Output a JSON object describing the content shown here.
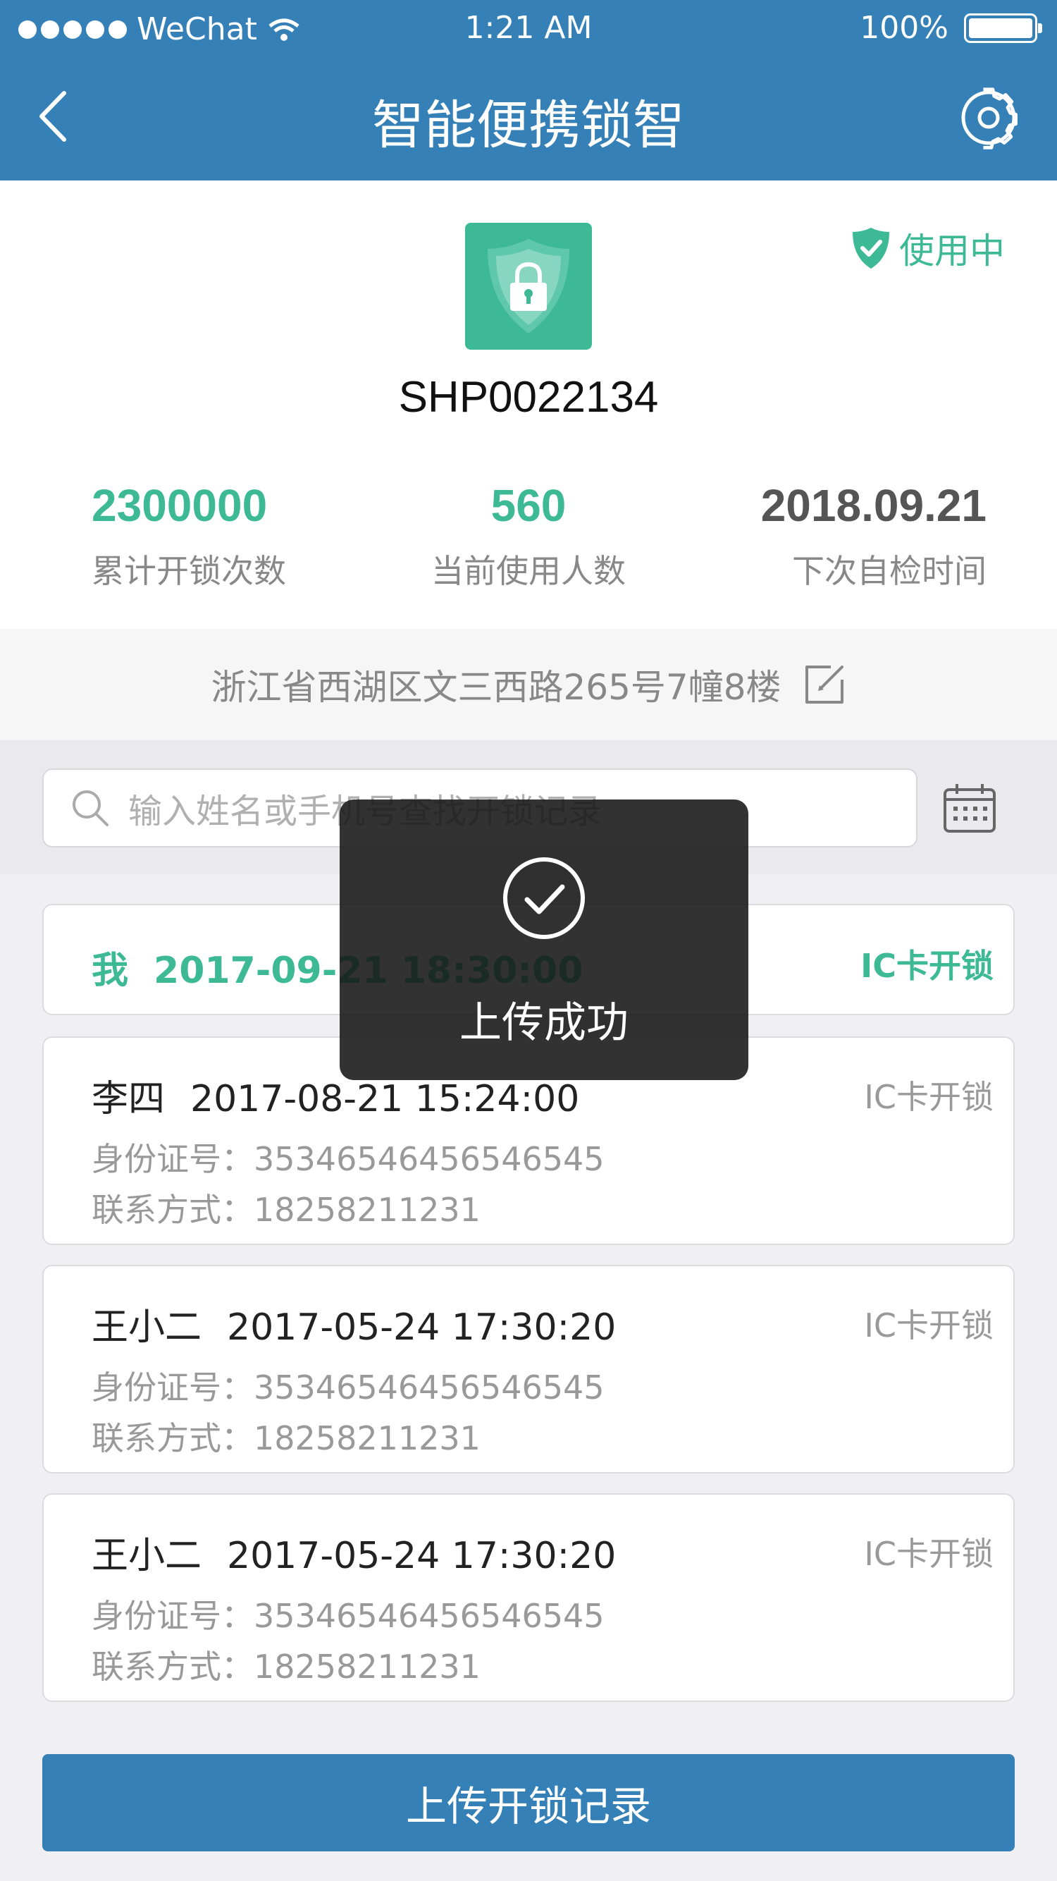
{
  "status_bar": {
    "carrier": "WeChat",
    "time": "1:21 AM",
    "battery": "100%"
  },
  "nav": {
    "title": "智能便携锁智",
    "back_icon": "chevron-left-icon",
    "settings_icon": "gear-icon"
  },
  "device": {
    "logo_icon": "shield-lock-icon",
    "status": "使用中",
    "id": "SHP0022134",
    "stats": [
      {
        "value": "2300000",
        "label": "累计开锁次数"
      },
      {
        "value": "560",
        "label": "当前使用人数"
      },
      {
        "value": "2018.09.21",
        "label": "下次自检时间"
      }
    ]
  },
  "address": {
    "text": "浙江省西湖区文三西路265号7幢8楼",
    "edit_icon": "edit-icon"
  },
  "search": {
    "placeholder": "输入姓名或手机号查找开锁记录",
    "icon": "search-icon",
    "calendar_icon": "calendar-icon"
  },
  "records": [
    {
      "name": "我",
      "time": "2017-09-21 18:30:00",
      "type": "IC卡开锁"
    },
    {
      "name": "李四",
      "time": "2017-08-21 15:24:00",
      "type": "IC卡开锁",
      "id_label": "身份证号：",
      "id_value": "35346546456546545",
      "contact_label": "联系方式：",
      "contact_value": "18258211231"
    },
    {
      "name": "王小二",
      "time": "2017-05-24 17:30:20",
      "type": "IC卡开锁",
      "id_label": "身份证号：",
      "id_value": "35346546456546545",
      "contact_label": "联系方式：",
      "contact_value": "18258211231"
    },
    {
      "name": "王小二",
      "time": "2017-05-24 17:30:20",
      "type": "IC卡开锁",
      "id_label": "身份证号：",
      "id_value": "35346546456546545",
      "contact_label": "联系方式：",
      "contact_value": "18258211231"
    }
  ],
  "upload_button": "上传开锁记录",
  "toast": {
    "message": "上传成功",
    "icon": "check-circle-icon"
  },
  "colors": {
    "primary": "#3580b6",
    "accent_green": "#3dba95"
  }
}
